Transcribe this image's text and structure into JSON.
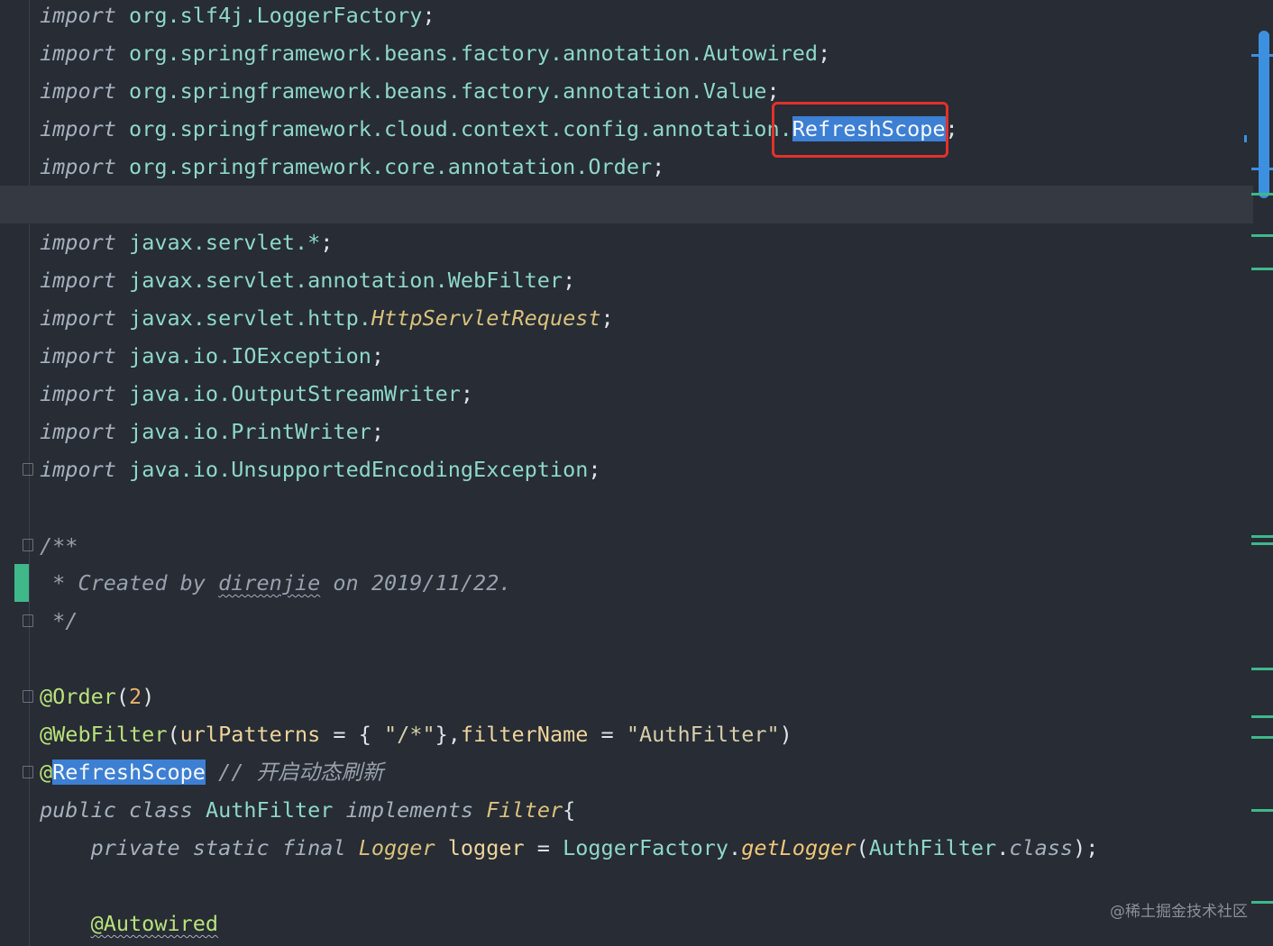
{
  "editor": {
    "imports_top": [
      {
        "kw": "import",
        "path": "org.slf4j.LoggerFactory",
        "end": ";"
      },
      {
        "kw": "import",
        "path": "org.springframework.beans.factory.annotation.Autowired",
        "end": ";"
      },
      {
        "kw": "import",
        "path": "org.springframework.beans.factory.annotation.Value",
        "end": ";"
      },
      {
        "kw": "import",
        "path": "org.springframework.cloud.context.config.annotation.",
        "selected": "RefreshScope",
        "end": ";"
      },
      {
        "kw": "import",
        "path": "org.springframework.core.annotation.Order",
        "end": ";"
      }
    ],
    "imports_bottom": [
      {
        "kw": "import",
        "path": "javax.servlet.*",
        "end": ";"
      },
      {
        "kw": "import",
        "path": "javax.servlet.annotation.WebFilter",
        "end": ";"
      },
      {
        "kw": "import",
        "path": "javax.servlet.http.",
        "italic_type": "HttpServletRequest",
        "end": ";"
      },
      {
        "kw": "import",
        "path": "java.io.IOException",
        "end": ";"
      },
      {
        "kw": "import",
        "path": "java.io.OutputStreamWriter",
        "end": ";"
      },
      {
        "kw": "import",
        "path": "java.io.PrintWriter",
        "end": ";"
      },
      {
        "kw": "import",
        "path": "java.io.UnsupportedEncodingException",
        "end": ";"
      }
    ],
    "doc_comment": {
      "open": "/**",
      "line_prefix": " * Created by ",
      "author": "direnjie",
      "line_suffix": " on 2019/11/22.",
      "close": " */"
    },
    "order_annotation": {
      "name": "@Order",
      "arg": "2"
    },
    "webfilter_annotation": {
      "name": "@WebFilter",
      "key1": "urlPatterns",
      "op": " = { ",
      "val1": "\"/*\"",
      "mid": "},",
      "key2": "filterName",
      "op2": " = ",
      "val2": "\"AuthFilter\"",
      "close": ")"
    },
    "refresh_annotation": {
      "at": "@",
      "name": "RefreshScope",
      "comment": " // 开启动态刷新"
    },
    "class_decl": {
      "public": "public",
      "class": "class",
      "name": "AuthFilter",
      "implements": "implements",
      "iface": "Filter",
      "brace": "{"
    },
    "logger_decl": {
      "mods": "private static final",
      "type": "Logger",
      "name": "logger",
      "eq": " = ",
      "factory": "LoggerFactory",
      "method": "getLogger",
      "arg_cls": "AuthFilter",
      "arg_kw": "class",
      "end": ");"
    },
    "autowired": "@Autowired"
  },
  "watermark": "@稀土掘金技术社区",
  "colors": {
    "background": "#272c35",
    "current_line": "#343942",
    "selection": "#3d7fd2",
    "highlight_box": "#e3312b",
    "change_marker": "#3fb88a"
  }
}
